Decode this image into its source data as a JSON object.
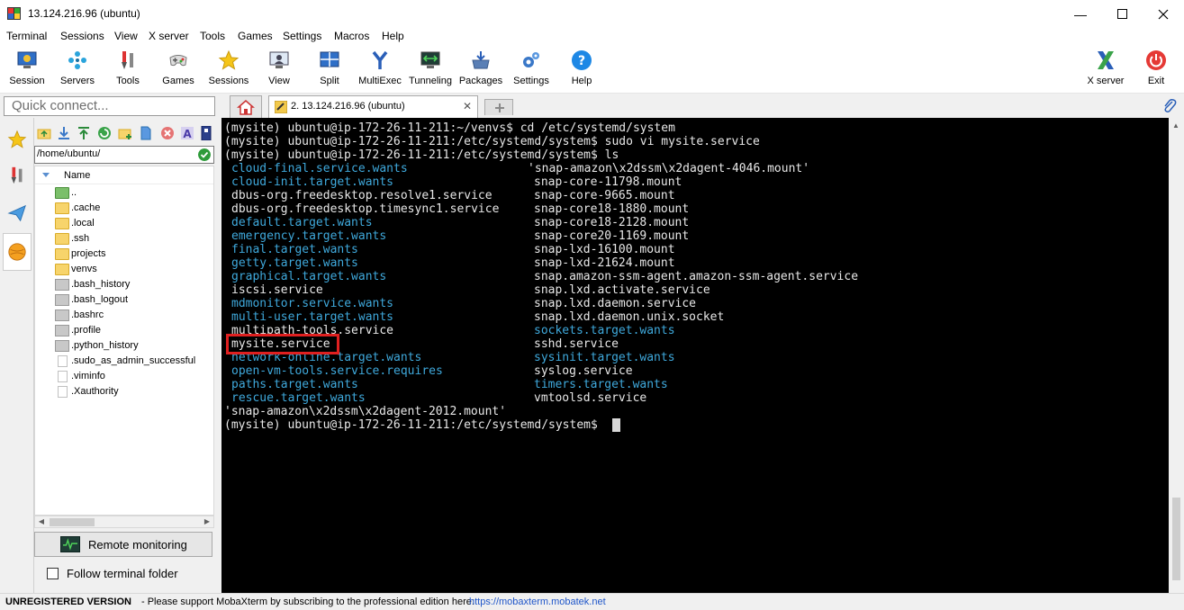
{
  "window": {
    "title": "13.124.216.96 (ubuntu)"
  },
  "menu": [
    "Terminal",
    "Sessions",
    "View",
    "X server",
    "Tools",
    "Games",
    "Settings",
    "Macros",
    "Help"
  ],
  "toolbar": {
    "session": "Session",
    "servers": "Servers",
    "tools": "Tools",
    "games": "Games",
    "sessions": "Sessions",
    "view": "View",
    "split": "Split",
    "multiexec": "MultiExec",
    "tunneling": "Tunneling",
    "packages": "Packages",
    "settings": "Settings",
    "help": "Help",
    "xserver": "X server",
    "exit": "Exit"
  },
  "quick_connect": {
    "placeholder": "Quick connect..."
  },
  "tabs": {
    "session_tab": "2. 13.124.216.96 (ubuntu)"
  },
  "filebrowser": {
    "path": "/home/ubuntu/",
    "column_name": "Name",
    "files": [
      "..",
      ".cache",
      ".local",
      ".ssh",
      "projects",
      "venvs",
      ".bash_history",
      ".bash_logout",
      ".bashrc",
      ".profile",
      ".python_history",
      ".sudo_as_admin_successful",
      ".viminfo",
      ".Xauthority"
    ],
    "remote_monitoring": "Remote monitoring",
    "follow_terminal": "Follow terminal folder"
  },
  "terminal": {
    "lines": [
      "(mysite) ubuntu@ip-172-26-11-211:~/venvs$ cd /etc/systemd/system",
      "(mysite) ubuntu@ip-172-26-11-211:/etc/systemd/system$ sudo vi mysite.service",
      "(mysite) ubuntu@ip-172-26-11-211:/etc/systemd/system$ ls"
    ],
    "col1": [
      "cloud-final.service.wants",
      "cloud-init.target.wants",
      "dbus-org.freedesktop.resolve1.service",
      "dbus-org.freedesktop.timesync1.service",
      "default.target.wants",
      "emergency.target.wants",
      "final.target.wants",
      "getty.target.wants",
      "graphical.target.wants",
      "iscsi.service",
      "mdmonitor.service.wants",
      "multi-user.target.wants",
      "multipath-tools.service",
      "mysite.service",
      "network-online.target.wants",
      "open-vm-tools.service.requires",
      "paths.target.wants",
      "rescue.target.wants"
    ],
    "col2": [
      "'snap-amazon\\x2dssm\\x2dagent-4046.mount'",
      "snap-core-11798.mount",
      "snap-core-9665.mount",
      "snap-core18-1880.mount",
      "snap-core18-2128.mount",
      "snap-core20-1169.mount",
      "snap-lxd-16100.mount",
      "snap-lxd-21624.mount",
      "snap.amazon-ssm-agent.amazon-ssm-agent.service",
      "snap.lxd.activate.service",
      "snap.lxd.daemon.service",
      "snap.lxd.daemon.unix.socket",
      "sockets.target.wants",
      "sshd.service",
      "sysinit.target.wants",
      "syslog.service",
      "timers.target.wants",
      "vmtoolsd.service"
    ],
    "tail": "'snap-amazon\\x2dssm\\x2dagent-2012.mount'",
    "prompt": "(mysite) ubuntu@ip-172-26-11-211:/etc/systemd/system$ "
  },
  "statusbar": {
    "unregistered": "UNREGISTERED VERSION",
    "message": "-  Please support MobaXterm by subscribing to the professional edition here:",
    "link": "https://mobaxterm.mobatek.net"
  },
  "colors": {
    "link_blue": "#3fa9dc",
    "highlight_red": "#e02020"
  }
}
